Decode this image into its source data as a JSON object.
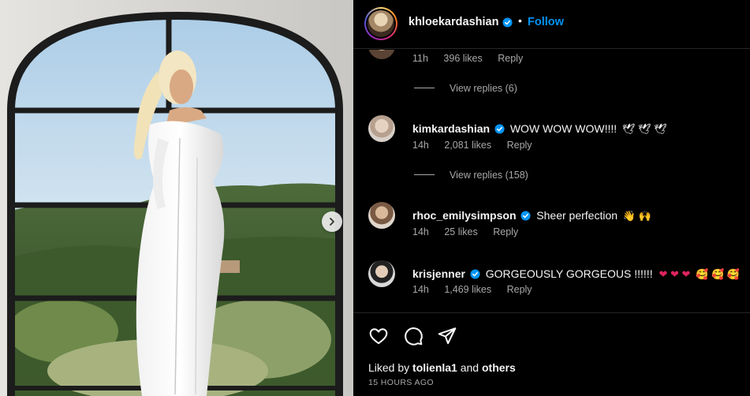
{
  "post": {
    "username": "khloekardashian",
    "separator": "•",
    "follow_label": "Follow"
  },
  "top_comment_meta": {
    "time": "11h",
    "likes": "396 likes",
    "reply": "Reply"
  },
  "view_replies_1": "View replies (6)",
  "comments": [
    {
      "username": "kimkardashian",
      "text": "WOW WOW WOW!!!!",
      "emoji": "🕊 🕊 🕊",
      "time": "14h",
      "likes": "2,081 likes",
      "reply": "Reply"
    },
    {
      "username": "rhoc_emilysimpson",
      "text": "Sheer perfection",
      "emoji": "👋 🙌",
      "time": "14h",
      "likes": "25 likes",
      "reply": "Reply"
    },
    {
      "username": "krisjenner",
      "text": "GORGEOUSLY GORGEOUS !!!!!!",
      "emoji_hearts": "❤ ❤ ❤",
      "emoji_faces": "🥰 🥰 🥰",
      "time": "14h",
      "likes": "1,469 likes",
      "reply": "Reply"
    }
  ],
  "view_replies_2": "View replies (158)",
  "liked_by": {
    "prefix": "Liked by",
    "user": "tolienla1",
    "and": "and",
    "others": "others"
  },
  "timestamp": "15 HOURS AGO",
  "colors": {
    "accent": "#0095f6",
    "verified": "#0095f6",
    "background": "#000000",
    "muted": "#a8a8a8"
  },
  "icons": [
    "heart-icon",
    "comment-icon",
    "share-icon",
    "verified-icon",
    "chevron-right-icon"
  ]
}
